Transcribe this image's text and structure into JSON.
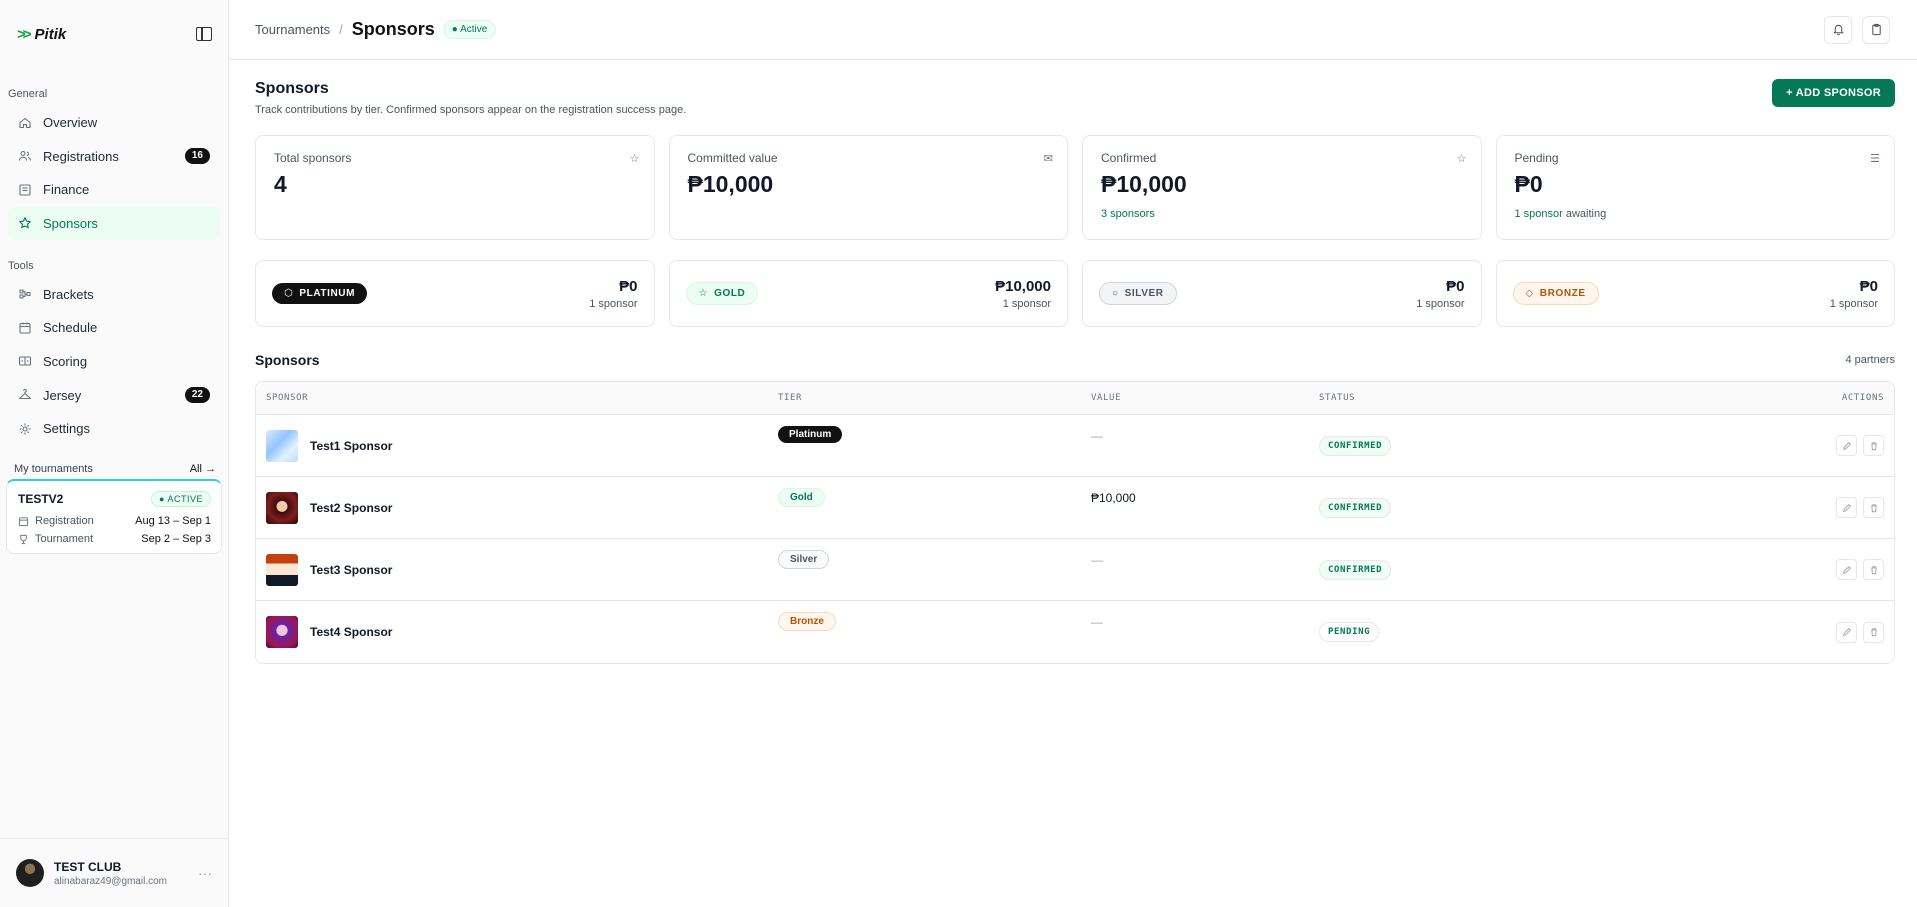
{
  "brand": {
    "name": "Pitik",
    "mark": ">>"
  },
  "sidebar": {
    "general_label": "General",
    "tools_label": "Tools",
    "general_items": [
      {
        "label": "Overview",
        "icon": "home-icon"
      },
      {
        "label": "Registrations",
        "icon": "users-icon",
        "badge": "16"
      },
      {
        "label": "Finance",
        "icon": "ledger-icon"
      },
      {
        "label": "Sponsors",
        "icon": "star-icon",
        "active": true
      }
    ],
    "tools_items": [
      {
        "label": "Brackets",
        "icon": "bracket-icon"
      },
      {
        "label": "Schedule",
        "icon": "calendar-icon"
      },
      {
        "label": "Scoring",
        "icon": "scoreboard-icon"
      },
      {
        "label": "Jersey",
        "icon": "hanger-icon",
        "badge": "22"
      },
      {
        "label": "Settings",
        "icon": "gear-icon"
      }
    ],
    "my_tournaments": {
      "label": "My tournaments",
      "all_label": "All →",
      "card": {
        "name": "TESTV2",
        "status": "● ACTIVE",
        "registration_label": "Registration",
        "registration_dates": "Aug 13 – Sep 1",
        "tournament_label": "Tournament",
        "tournament_dates": "Sep 2 – Sep 3"
      }
    },
    "user": {
      "name": "TEST CLUB",
      "email": "alinabaraz49@gmail.com",
      "more": "···"
    }
  },
  "topbar": {
    "crumb": "Tournaments",
    "separator": "/",
    "title": "Sponsors",
    "status": "● Active"
  },
  "page": {
    "title": "Sponsors",
    "subtitle": "Track contributions by tier. Confirmed sponsors appear on the registration success page.",
    "add_button": "+ ADD SPONSOR"
  },
  "stats": [
    {
      "label": "Total sponsors",
      "value": "4",
      "icon": "star-outline-icon",
      "glyph": "☆"
    },
    {
      "label": "Committed value",
      "value": "₱10,000",
      "icon": "mail-icon",
      "glyph": "✉"
    },
    {
      "label": "Confirmed",
      "value": "₱10,000",
      "icon": "star-icon",
      "glyph": "☆",
      "foot_green": "3 sponsors",
      "foot_rest": ""
    },
    {
      "label": "Pending",
      "value": "₱0",
      "icon": "list-icon",
      "glyph": "☰",
      "foot_green": "1 sponsor",
      "foot_rest": " awaiting"
    }
  ],
  "tiers": [
    {
      "name": "PLATINUM",
      "glyph": "⬡",
      "value": "₱0",
      "count": "1 sponsor"
    },
    {
      "name": "GOLD",
      "glyph": "☆",
      "value": "₱10,000",
      "count": "1 sponsor"
    },
    {
      "name": "SILVER",
      "glyph": "○",
      "value": "₱0",
      "count": "1 sponsor"
    },
    {
      "name": "BRONZE",
      "glyph": "◇",
      "value": "₱0",
      "count": "1 sponsor"
    }
  ],
  "sponsors_list": {
    "title": "Sponsors",
    "count": "4 partners",
    "columns": [
      "SPONSOR",
      "TIER",
      "VALUE",
      "STATUS",
      "ACTIONS"
    ],
    "rows": [
      {
        "name": "Test1 Sponsor",
        "tier": "Platinum",
        "value": "—",
        "status": "CONFIRMED"
      },
      {
        "name": "Test2 Sponsor",
        "tier": "Gold",
        "value": "₱10,000",
        "status": "CONFIRMED"
      },
      {
        "name": "Test3 Sponsor",
        "tier": "Silver",
        "value": "—",
        "status": "CONFIRMED"
      },
      {
        "name": "Test4 Sponsor",
        "tier": "Bronze",
        "value": "—",
        "status": "PENDING"
      }
    ]
  },
  "colors": {
    "accent": "#047857",
    "active_bg": "#ecfdf3"
  }
}
